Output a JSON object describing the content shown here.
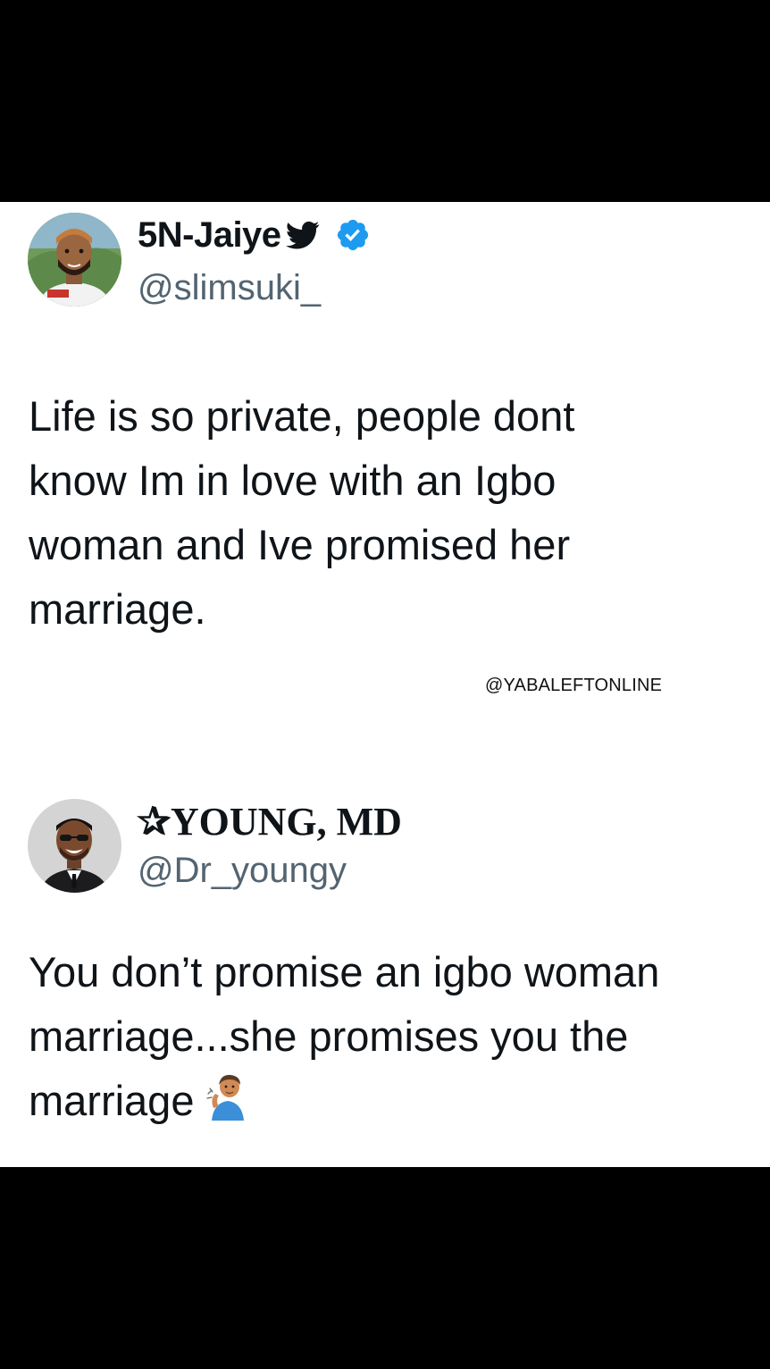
{
  "tweets": [
    {
      "display_name": "5N-Jaiye",
      "handle": "@slimsuki_",
      "badges": [
        "twitter-bird-icon",
        "verified-badge-icon"
      ],
      "text_lines": [
        "Life is so private, people dont",
        "know Im in love with an Igbo",
        "woman and Ive promised her",
        "marriage."
      ]
    },
    {
      "display_name": "✰YOUNG, MD",
      "handle": "@Dr_youngy",
      "text_lines": [
        "You don’t promise an igbo woman",
        "marriage...she promises you the",
        "marriage"
      ],
      "trailing_icon": "person-tipping-hand-icon"
    }
  ],
  "watermark": "@YABALEFTONLINE",
  "colors": {
    "background": "#000000",
    "card": "#ffffff",
    "text": "#0f1419",
    "handle": "#536471",
    "verified": "#1d9bf0"
  }
}
